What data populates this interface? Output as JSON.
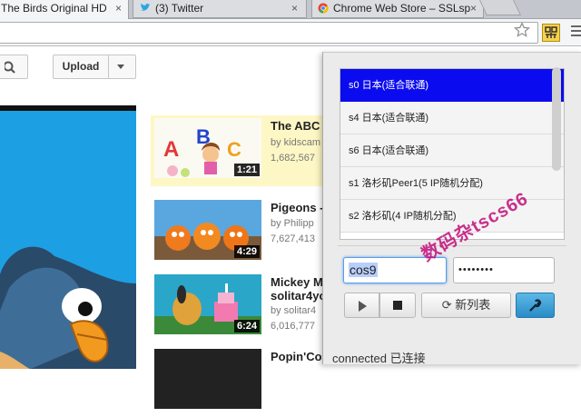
{
  "browser": {
    "tabs": [
      {
        "label": "The Birds Original HD",
        "close": "×"
      },
      {
        "label": "(3) Twitter",
        "close": "×"
      },
      {
        "label": "Chrome Web Store – SSLsp",
        "close": "×"
      }
    ],
    "toolbar": {
      "star_icon": "star-icon",
      "extension_icon": "proxy-extension-icon",
      "menu_icon": "menu-icon"
    }
  },
  "youtube": {
    "upload_label": "Upload",
    "videos": [
      {
        "title": "The ABC",
        "channel": "by kidscam",
        "views": "1,682,567",
        "duration": "1:21",
        "highlighted": true
      },
      {
        "title": "Pigeons -",
        "channel": "by Philipp",
        "views": "7,627,413",
        "duration": "4:29",
        "highlighted": false
      },
      {
        "title": "Mickey M",
        "subtitle": "solitar4yo",
        "channel": "by solitar4",
        "views": "6,016,777",
        "duration": "6:24",
        "highlighted": false
      },
      {
        "title": "Popin'Co",
        "highlighted": false
      }
    ]
  },
  "popup": {
    "servers": [
      {
        "label": "s0 日本(适合联通)",
        "selected": true
      },
      {
        "label": "s4 日本(适合联通)",
        "selected": false
      },
      {
        "label": "s6 日本(适合联通)",
        "selected": false
      },
      {
        "label": "s1 洛杉矶Peer1(5 IP随机分配)",
        "selected": false
      },
      {
        "label": "s2 洛杉矶(4 IP随机分配)",
        "selected": false
      }
    ],
    "username": "cos9",
    "password_mask": "••••••••",
    "refresh_label": "新列表",
    "status": "connected 已连接",
    "colors": {
      "selected_bg": "#0b0bef",
      "settings_button": "#2a8cc7"
    }
  },
  "watermark": "数码杂tscs66"
}
